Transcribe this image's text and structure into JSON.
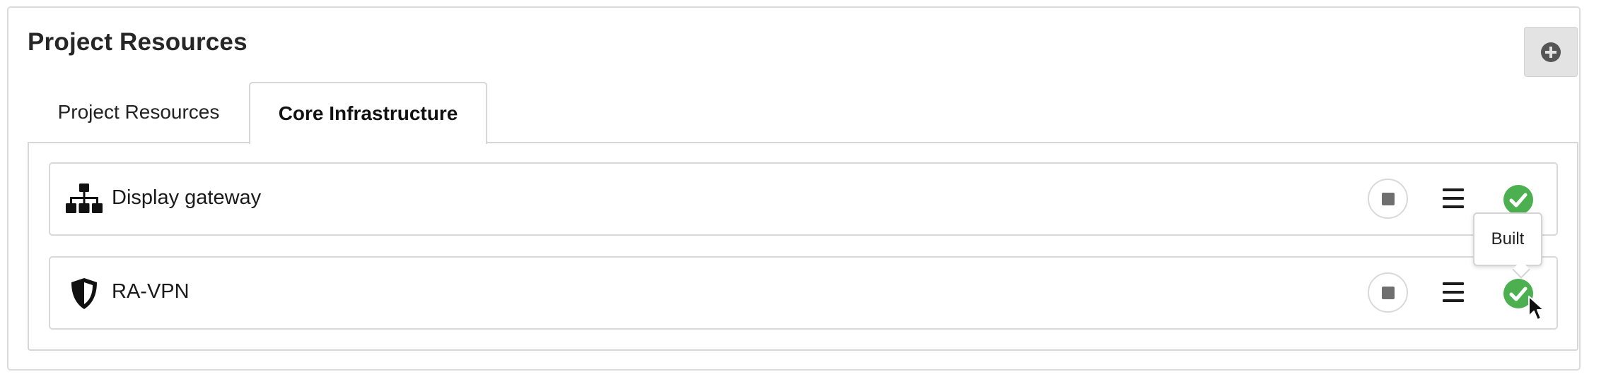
{
  "panel": {
    "title": "Project Resources",
    "add_button_icon": "plus-circle-icon"
  },
  "tabs": [
    {
      "label": "Project Resources",
      "active": false
    },
    {
      "label": "Core Infrastructure",
      "active": true
    }
  ],
  "resources": [
    {
      "name": "Display gateway",
      "icon": "network-topology-icon",
      "status": "built",
      "status_icon": "check-circle-icon"
    },
    {
      "name": "RA-VPN",
      "icon": "shield-icon",
      "status": "built",
      "status_icon": "check-circle-icon"
    }
  ],
  "tooltip": {
    "text": "Built"
  },
  "colors": {
    "success": "#4caf50",
    "button_bg": "#e3e3e3",
    "border": "#d9d9d9",
    "stop": "#6f6f6f"
  }
}
